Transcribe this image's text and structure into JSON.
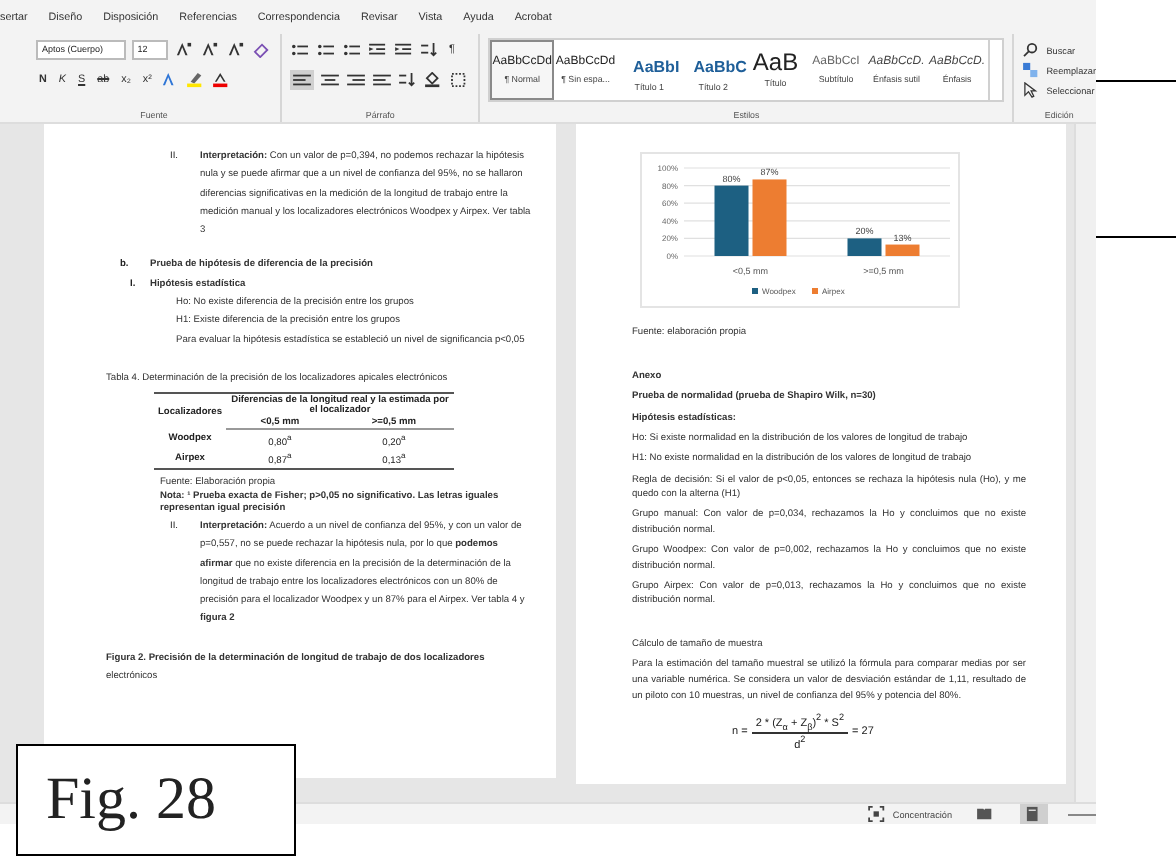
{
  "ribbon": {
    "tabs": [
      {
        "label": "sertar",
        "selected": false
      },
      {
        "label": "Diseño",
        "selected": false
      },
      {
        "label": "Disposición",
        "selected": false
      },
      {
        "label": "Referencias",
        "selected": false
      },
      {
        "label": "Correspondencia",
        "selected": false
      },
      {
        "label": "Revisar",
        "selected": false
      },
      {
        "label": "Vista",
        "selected": false
      },
      {
        "label": "Ayuda",
        "selected": false
      },
      {
        "label": "Acrobat",
        "selected": false
      }
    ],
    "font_name": "Aptos (Cuerpo)",
    "font_size": "12",
    "format_buttons": [
      {
        "label": "N",
        "kind": "bold"
      },
      {
        "label": "K",
        "kind": "italic"
      },
      {
        "label": "S",
        "kind": "underline"
      },
      {
        "label": "ab",
        "kind": "strike"
      },
      {
        "label": "x₂",
        "kind": "plain"
      },
      {
        "label": "x²",
        "kind": "plain"
      }
    ],
    "pilcrow": "¶",
    "styles": [
      {
        "preview": "AaBbCcDd",
        "label": "¶ Normal",
        "kind": "normal",
        "selected": true
      },
      {
        "preview": "AaBbCcDd",
        "label": "¶ Sin espa...",
        "kind": "normal",
        "selected": false
      },
      {
        "preview": "AaBbI",
        "label": "Título 1",
        "kind": "heading",
        "selected": false
      },
      {
        "preview": "AaBbC",
        "label": "Título 2",
        "kind": "heading",
        "selected": false
      },
      {
        "preview": "AaB",
        "label": "Título",
        "kind": "title",
        "selected": false
      },
      {
        "preview": "AaBbCcI",
        "label": "Subtítulo",
        "kind": "subtitle",
        "selected": false
      },
      {
        "preview": "AaBbCcD.",
        "label": "Énfasis sutil",
        "kind": "emphasis",
        "selected": false
      },
      {
        "preview": "AaBbCcD.",
        "label": "Énfasis",
        "kind": "emphasis",
        "selected": false
      }
    ],
    "groups": [
      "Fuente",
      "Párrafo",
      "Estilos",
      "Edición"
    ],
    "editing": [
      {
        "label": "Buscar",
        "kind": "search"
      },
      {
        "label": "Reemplazar",
        "kind": "replace"
      },
      {
        "label": "Seleccionar",
        "kind": "select"
      }
    ]
  },
  "left_page": {
    "blocks": [
      {
        "kind": "item",
        "marker": "II.",
        "text": "**Interpretación:** Con un valor de p=0,394, no podemos rechazar la hipótesis nula y se puede afirmar que a un nivel de confianza del 95%, no se hallaron diferencias significativas en la medición de la longitud de trabajo entre la medición manual y los localizadores electrónicos Woodpex y Airpex. Ver tabla 3"
      },
      {
        "kind": "heading",
        "marker": "b.",
        "text": "Prueba de hipótesis de diferencia de la precisión"
      },
      {
        "kind": "subheading",
        "marker": "I.",
        "text": "Hipótesis estadística"
      },
      {
        "kind": "indented",
        "text": "Ho: No existe diferencia de la precisión entre los grupos"
      },
      {
        "kind": "indented",
        "text": "H1: Existe diferencia de la precisión entre los grupos"
      },
      {
        "kind": "indented",
        "text": "Para evaluar la hipótesis estadística se estableció un nivel de significancia p<0,05"
      },
      {
        "kind": "caption",
        "text": "Tabla 4. Determinación de la precisión de los localizadores apicales electrónicos"
      },
      {
        "kind": "table",
        "header": "Localizadores",
        "group_header": "Diferencias de la longitud real y la estimada por el localizador",
        "columns": [
          "<0,5 mm",
          ">=0,5 mm"
        ],
        "rows": [
          {
            "name": "Woodpex",
            "cells": [
              "0,80$^{a}$",
              "0,20$^{a}$"
            ]
          },
          {
            "name": "Airpex",
            "cells": [
              "0,87$^{a}$",
              "0,13$^{a}$"
            ]
          }
        ]
      },
      {
        "kind": "note",
        "text": "Fuente: Elaboración propia"
      },
      {
        "kind": "note",
        "text": "**Nota: ¹ Prueba exacta de Fisher; p>0,05 no significativo. Las letras iguales representan igual precisión**"
      },
      {
        "kind": "item",
        "marker": "II.",
        "text": "**Interpretación:** Acuerdo a un nivel de confianza del 95%, y con un valor de p=0,557, no se puede rechazar la hipótesis nula, por lo que **podemos afirmar** que no existe diferencia en la precisión de la determinación de la longitud de trabajo entre los localizadores electrónicos con un 80% de precisión para el localizador Woodpex y un 87% para el Airpex. Ver tabla 4 y **figura 2**"
      },
      {
        "kind": "caption",
        "text": "**Figura 2. Precisión de la determinación de longitud de trabajo de dos localizadores** electrónicos"
      }
    ]
  },
  "right_page": {
    "blocks": [
      {
        "kind": "chart",
        "chart_data": {
          "type": "bar",
          "categories": [
            "<0,5 mm",
            ">=0,5 mm"
          ],
          "series": [
            {
              "name": "Woodpex",
              "color": "#1d6082",
              "values": [
                80,
                20
              ],
              "value_labels": [
                "80%",
                "20%"
              ]
            },
            {
              "name": "Airpex",
              "color": "#ed7d31",
              "values": [
                87,
                13
              ],
              "value_labels": [
                "87%",
                "13%"
              ]
            }
          ],
          "grid": true,
          "legend": true,
          "ylim": [
            0,
            100
          ],
          "yticks": [
            {
              "value": 0,
              "label": "0%"
            },
            {
              "value": 20,
              "label": "20%"
            },
            {
              "value": 40,
              "label": "40%"
            },
            {
              "value": 60,
              "label": "60%"
            },
            {
              "value": 80,
              "label": "80%"
            },
            {
              "value": 100,
              "label": "100%"
            }
          ],
          "data_labels": true
        }
      },
      {
        "kind": "para",
        "text": "Fuente: elaboración propia"
      },
      {
        "kind": "heading",
        "text": "Anexo"
      },
      {
        "kind": "heading",
        "text": "Prueba de normalidad (prueba de Shapiro Wilk, n=30)"
      },
      {
        "kind": "heading",
        "text": "Hipótesis estadísticas:"
      },
      {
        "kind": "para",
        "text": "Ho: Si existe normalidad en la distribución de los valores de longitud de trabajo"
      },
      {
        "kind": "para",
        "text": "H1: No existe normalidad en la distribución de los valores de longitud de trabajo"
      },
      {
        "kind": "para",
        "text": "Regla de decisión: Si el valor de p<0,05, entonces se rechaza la hipótesis nula (Ho), y me quedo con la alterna (H1)"
      },
      {
        "kind": "para",
        "text": "Grupo manual: Con valor de p=0,034, rechazamos la Ho y concluimos que no existe distribución normal."
      },
      {
        "kind": "para",
        "text": "Grupo Woodpex: Con valor de p=0,002, rechazamos la Ho y concluimos que no existe distribución normal."
      },
      {
        "kind": "para",
        "text": "Grupo Airpex: Con valor de p=0,013, rechazamos la Ho y concluimos que no existe distribución normal."
      },
      {
        "kind": "section",
        "text": "Cálculo de tamaño de muestra"
      },
      {
        "kind": "para",
        "text": "Para la estimación del tamaño muestral se utilizó la fórmula para comparar medias por ser una variable numérica. Se considera un valor de desviación estándar de 1,11, resultado de un piloto con 10 muestras, un nivel de confianza del 95% y potencia del 80%."
      },
      {
        "kind": "formula",
        "lhs": "n =",
        "numerator": "2 * (Z$_{α}$ + Z$_{β}$)$^{2}$ * S$^{2}$",
        "denominator": "d$^{2}$",
        "rhs": "= 27"
      }
    ]
  },
  "status_bar": {
    "focus": "Concentración",
    "views": [
      {
        "kind": "read",
        "selected": false
      },
      {
        "kind": "print",
        "selected": true
      }
    ]
  },
  "figure_label": "Fig. 28"
}
